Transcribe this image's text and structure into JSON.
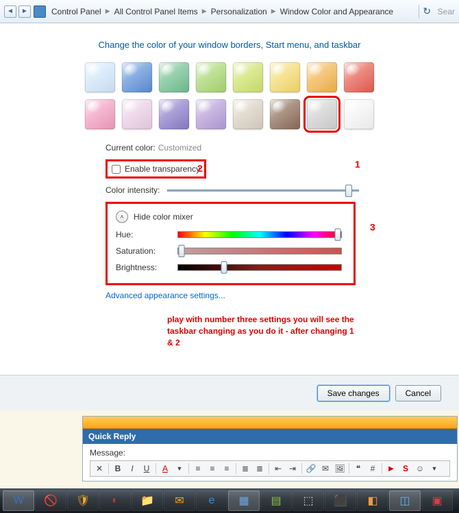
{
  "breadcrumb": {
    "items": [
      "Control Panel",
      "All Control Panel Items",
      "Personalization",
      "Window Color and Appearance"
    ],
    "search_placeholder": "Sear"
  },
  "heading": "Change the color of your window borders, Start menu, and taskbar",
  "swatches": {
    "row1": [
      "#cfe5fa",
      "#5a8ed8",
      "#6fbf8f",
      "#a7d66f",
      "#cde26a",
      "#f4d96c",
      "#f2b24a",
      "#e65b4e"
    ],
    "row2": [
      "#f29bbd",
      "#e9cde5",
      "#8a7bc8",
      "#b49bd8",
      "#d8cfc0",
      "#8a6a55",
      "#d0d0d0",
      "#f4f4f4"
    ],
    "selected_index": 14
  },
  "labels": {
    "current_color": "Current color:",
    "current_color_value": "Customized",
    "enable_transparency": "Enable transparency",
    "color_intensity": "Color intensity:",
    "hide_mixer": "Hide color mixer",
    "hue": "Hue:",
    "saturation": "Saturation:",
    "brightness": "Brightness:",
    "advanced": "Advanced appearance settings..."
  },
  "sliders": {
    "intensity_pct": 95,
    "hue_pct": 98,
    "saturation_pct": 2,
    "brightness_pct": 28
  },
  "annotations": {
    "a1": "1",
    "a2": "2",
    "a3": "3"
  },
  "note": "play with number three settings you will see the taskbar changing as you do it - after changing 1 & 2",
  "buttons": {
    "save": "Save changes",
    "cancel": "Cancel"
  },
  "forum": {
    "title": "Quick Reply",
    "msg_label": "Message:"
  }
}
